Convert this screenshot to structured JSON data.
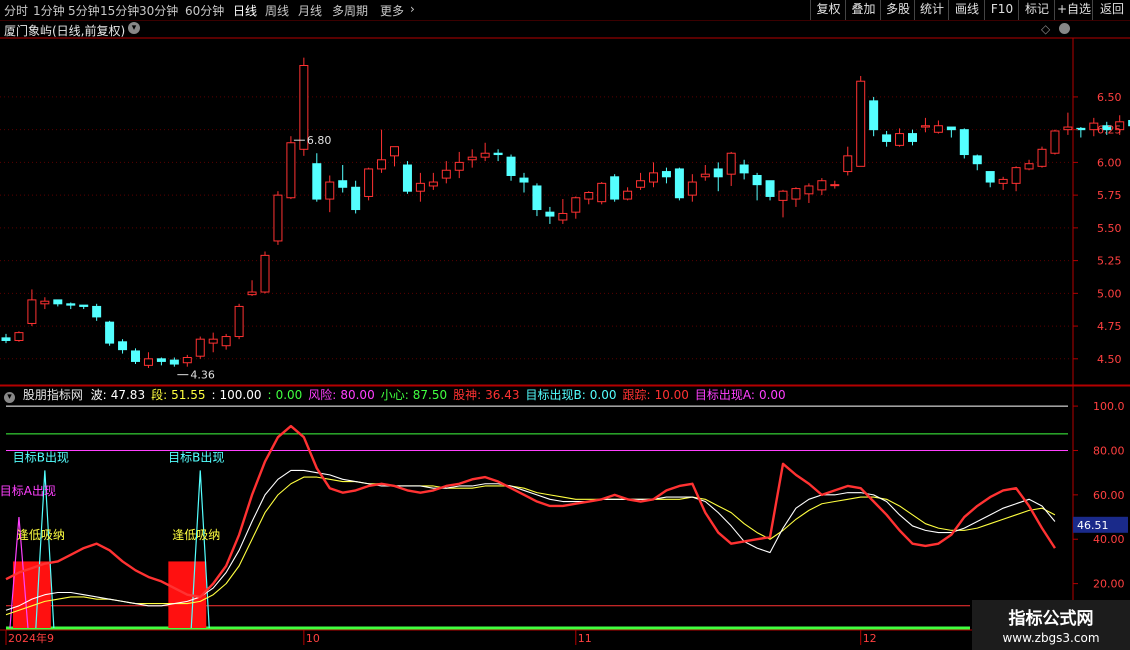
{
  "toolbar": {
    "periods": [
      "分时",
      "1分钟",
      "5分钟",
      "15分钟",
      "30分钟",
      "60分钟",
      "日线",
      "周线",
      "月线",
      "多周期",
      "更多"
    ],
    "active_period": "日线",
    "right_buttons": [
      "复权",
      "叠加",
      "多股",
      "统计",
      "画线",
      "F10",
      "标记",
      "+自选",
      "返回"
    ]
  },
  "title": {
    "stock_name": "厦门象屿(日线,前复权)"
  },
  "colors": {
    "up": "#ff3232",
    "down": "#54ffff",
    "grid": "#5a0000",
    "axis": "#b40000",
    "wave_line": "#ff2020",
    "seg_line": "#ffff40",
    "mid_line": "#ffffff",
    "target_b": "#54ffff",
    "target_a": "#ff40ff"
  },
  "chart_data": [
    {
      "type": "candlestick",
      "title": "厦门象屿(日线,前复权)",
      "ylim": [
        4.3,
        6.95
      ],
      "y_ticks": [
        "6.50",
        "6.25",
        "6.00",
        "5.75",
        "5.50",
        "5.25",
        "5.00",
        "4.75",
        "4.50"
      ],
      "annotations": [
        {
          "text": "6.80",
          "candle_index": 22
        },
        {
          "text": "4.36",
          "candle_index": 13
        }
      ],
      "candles": [
        [
          4.66,
          4.64,
          4.69,
          4.62
        ],
        [
          4.64,
          4.7,
          4.71,
          4.63
        ],
        [
          4.77,
          4.95,
          5.03,
          4.75
        ],
        [
          4.92,
          4.94,
          4.97,
          4.88
        ],
        [
          4.95,
          4.92,
          4.95,
          4.9
        ],
        [
          4.92,
          4.91,
          4.93,
          4.88
        ],
        [
          4.91,
          4.9,
          4.91,
          4.88
        ],
        [
          4.9,
          4.82,
          4.92,
          4.79
        ],
        [
          4.78,
          4.62,
          4.79,
          4.6
        ],
        [
          4.63,
          4.57,
          4.65,
          4.54
        ],
        [
          4.56,
          4.48,
          4.58,
          4.46
        ],
        [
          4.45,
          4.5,
          4.55,
          4.43
        ],
        [
          4.5,
          4.48,
          4.51,
          4.45
        ],
        [
          4.49,
          4.46,
          4.51,
          4.44
        ],
        [
          4.47,
          4.51,
          4.53,
          4.44
        ],
        [
          4.52,
          4.65,
          4.67,
          4.5
        ],
        [
          4.62,
          4.65,
          4.7,
          4.55
        ],
        [
          4.6,
          4.67,
          4.69,
          4.57
        ],
        [
          4.67,
          4.9,
          4.92,
          4.65
        ],
        [
          4.99,
          5.01,
          5.1,
          4.98
        ],
        [
          5.01,
          5.29,
          5.32,
          5.0
        ],
        [
          5.4,
          5.75,
          5.78,
          5.37
        ],
        [
          5.73,
          6.15,
          6.2,
          5.72
        ],
        [
          6.1,
          6.74,
          6.8,
          6.05
        ],
        [
          5.99,
          5.72,
          6.07,
          5.7
        ],
        [
          5.72,
          5.85,
          5.9,
          5.62
        ],
        [
          5.86,
          5.81,
          5.98,
          5.77
        ],
        [
          5.81,
          5.64,
          5.86,
          5.61
        ],
        [
          5.74,
          5.95,
          5.96,
          5.71
        ],
        [
          5.95,
          6.02,
          6.25,
          5.92
        ],
        [
          6.05,
          6.12,
          6.12,
          5.97
        ],
        [
          5.98,
          5.78,
          6.01,
          5.76
        ],
        [
          5.78,
          5.84,
          5.92,
          5.7
        ],
        [
          5.82,
          5.85,
          5.92,
          5.79
        ],
        [
          5.88,
          5.94,
          6.01,
          5.84
        ],
        [
          5.94,
          6.0,
          6.08,
          5.88
        ],
        [
          6.02,
          6.04,
          6.1,
          5.96
        ],
        [
          6.04,
          6.07,
          6.15,
          6.01
        ],
        [
          6.07,
          6.06,
          6.1,
          6.01
        ],
        [
          6.04,
          5.9,
          6.06,
          5.86
        ],
        [
          5.88,
          5.85,
          5.92,
          5.77
        ],
        [
          5.82,
          5.64,
          5.84,
          5.59
        ],
        [
          5.62,
          5.59,
          5.66,
          5.53
        ],
        [
          5.56,
          5.61,
          5.72,
          5.53
        ],
        [
          5.62,
          5.73,
          5.74,
          5.57
        ],
        [
          5.72,
          5.77,
          5.78,
          5.68
        ],
        [
          5.7,
          5.84,
          5.85,
          5.68
        ],
        [
          5.89,
          5.72,
          5.91,
          5.7
        ],
        [
          5.72,
          5.78,
          5.81,
          5.71
        ],
        [
          5.81,
          5.86,
          5.92,
          5.79
        ],
        [
          5.85,
          5.92,
          6.0,
          5.81
        ],
        [
          5.93,
          5.89,
          5.96,
          5.84
        ],
        [
          5.95,
          5.73,
          5.96,
          5.71
        ],
        [
          5.75,
          5.85,
          5.91,
          5.7
        ],
        [
          5.89,
          5.91,
          5.98,
          5.86
        ],
        [
          5.95,
          5.89,
          6.0,
          5.78
        ],
        [
          5.91,
          6.07,
          6.08,
          5.82
        ],
        [
          5.98,
          5.92,
          6.02,
          5.87
        ],
        [
          5.9,
          5.83,
          5.92,
          5.71
        ],
        [
          5.86,
          5.74,
          5.86,
          5.71
        ],
        [
          5.71,
          5.78,
          5.79,
          5.58
        ],
        [
          5.72,
          5.8,
          5.81,
          5.66
        ],
        [
          5.76,
          5.82,
          5.84,
          5.69
        ],
        [
          5.79,
          5.86,
          5.88,
          5.75
        ],
        [
          5.83,
          5.83,
          5.86,
          5.8
        ],
        [
          5.93,
          6.05,
          6.12,
          5.9
        ],
        [
          5.97,
          6.62,
          6.66,
          5.98
        ],
        [
          6.47,
          6.25,
          6.5,
          6.2
        ],
        [
          6.21,
          6.16,
          6.24,
          6.12
        ],
        [
          6.13,
          6.22,
          6.26,
          6.12
        ],
        [
          6.22,
          6.16,
          6.25,
          6.13
        ],
        [
          6.27,
          6.28,
          6.34,
          6.23
        ],
        [
          6.23,
          6.28,
          6.32,
          6.22
        ],
        [
          6.27,
          6.25,
          6.27,
          6.19
        ],
        [
          6.25,
          6.06,
          6.26,
          6.03
        ],
        [
          6.05,
          5.99,
          6.06,
          5.94
        ],
        [
          5.93,
          5.85,
          5.93,
          5.81
        ],
        [
          5.84,
          5.87,
          5.89,
          5.79
        ],
        [
          5.84,
          5.96,
          5.97,
          5.78
        ],
        [
          5.95,
          5.99,
          6.02,
          5.94
        ],
        [
          5.97,
          6.1,
          6.12,
          5.96
        ],
        [
          6.07,
          6.24,
          6.25,
          6.06
        ],
        [
          6.25,
          6.27,
          6.38,
          6.21
        ],
        [
          6.26,
          6.25,
          6.27,
          6.19
        ],
        [
          6.25,
          6.3,
          6.34,
          6.2
        ],
        [
          6.28,
          6.25,
          6.31,
          6.21
        ],
        [
          6.25,
          6.31,
          6.36,
          6.21
        ],
        [
          6.32,
          6.28,
          6.35,
          6.22
        ],
        [
          6.27,
          6.13,
          6.33,
          6.1
        ],
        [
          6.1,
          5.95,
          6.17,
          5.93
        ],
        [
          5.95,
          5.84,
          5.97,
          5.8
        ],
        [
          5.86,
          5.86,
          5.88,
          5.77
        ]
      ]
    },
    {
      "type": "line",
      "title": "股朋指标网",
      "ylim": [
        0,
        105
      ],
      "y_ticks": [
        "100.0",
        "80.00",
        "60.00",
        "40.00",
        "20.00"
      ],
      "current_value": "46.51",
      "x_ticks": [
        {
          "label": "2024年9",
          "index": 0
        },
        {
          "label": "10",
          "index": 23
        },
        {
          "label": "11",
          "index": 44
        },
        {
          "label": "12",
          "index": 66
        }
      ],
      "header": [
        {
          "label": "波:",
          "value": "47.83",
          "color": "#ffffff"
        },
        {
          "label": "段:",
          "value": "51.55",
          "color": "#ffff40"
        },
        {
          "label": ":",
          "value": "100.00",
          "color": "#ffffff"
        },
        {
          "label": ":",
          "value": "0.00",
          "color": "#40ff40"
        },
        {
          "label": "风险:",
          "value": "80.00",
          "color": "#ff40ff"
        },
        {
          "label": "小心:",
          "value": "87.50",
          "color": "#40ff40"
        },
        {
          "label": "股神:",
          "value": "36.43",
          "color": "#ff3232"
        },
        {
          "label": "目标出现B:",
          "value": "0.00",
          "color": "#54ffff"
        },
        {
          "label": "跟踪:",
          "value": "10.00",
          "color": "#ff3232"
        },
        {
          "label": "目标出现A:",
          "value": "0.00",
          "color": "#ff40ff"
        }
      ],
      "hlines": [
        {
          "value": 100,
          "color": "#ffffff"
        },
        {
          "value": 87.5,
          "color": "#40ff40"
        },
        {
          "value": 80,
          "color": "#ff40ff"
        },
        {
          "value": 10,
          "color": "#ff3232"
        },
        {
          "value": 0,
          "color": "#40ff40"
        }
      ],
      "series": [
        {
          "key": "guoshen",
          "color": "#ff3232",
          "values": [
            22,
            25,
            27,
            29,
            30,
            33,
            36,
            38,
            35,
            30,
            26,
            23,
            21,
            18,
            15,
            14,
            20,
            28,
            42,
            60,
            75,
            86,
            91,
            86,
            72,
            63,
            61,
            62,
            64,
            65,
            64,
            62,
            61,
            62,
            64,
            65,
            67,
            68,
            66,
            63,
            60,
            57,
            55,
            55,
            56,
            57,
            58,
            60,
            58,
            57,
            58,
            62,
            64,
            65,
            52,
            43,
            38,
            39,
            40,
            41,
            74,
            69,
            65,
            60,
            62,
            64,
            63,
            57,
            51,
            44,
            38,
            37,
            38,
            42,
            50,
            55,
            59,
            62,
            63,
            55,
            45,
            36
          ]
        },
        {
          "key": "wave",
          "color": "#ffffff",
          "values": [
            8,
            10,
            13,
            15,
            16,
            16,
            15,
            14,
            13,
            12,
            11,
            10,
            10,
            11,
            12,
            14,
            18,
            25,
            35,
            48,
            60,
            67,
            71,
            71,
            70,
            69,
            67,
            66,
            65,
            64,
            64,
            64,
            64,
            63,
            63,
            64,
            64,
            65,
            65,
            64,
            62,
            60,
            58,
            57,
            57,
            57,
            58,
            58,
            58,
            58,
            58,
            59,
            59,
            59,
            57,
            52,
            46,
            39,
            36,
            34,
            45,
            54,
            58,
            60,
            60,
            61,
            61,
            60,
            57,
            51,
            46,
            44,
            43,
            43,
            45,
            48,
            51,
            54,
            56,
            58,
            55,
            48
          ]
        },
        {
          "key": "segment",
          "color": "#ffff40",
          "values": [
            6,
            8,
            10,
            12,
            13,
            14,
            14,
            13,
            13,
            12,
            11,
            11,
            11,
            11,
            11,
            12,
            15,
            20,
            28,
            40,
            52,
            60,
            65,
            68,
            68,
            67,
            66,
            66,
            65,
            65,
            64,
            64,
            64,
            64,
            63,
            63,
            63,
            64,
            64,
            64,
            63,
            61,
            60,
            59,
            58,
            58,
            58,
            58,
            58,
            58,
            58,
            58,
            58,
            59,
            58,
            55,
            52,
            47,
            43,
            40,
            44,
            49,
            53,
            56,
            57,
            58,
            59,
            59,
            58,
            55,
            51,
            47,
            45,
            44,
            44,
            45,
            47,
            49,
            51,
            53,
            54,
            51
          ]
        }
      ],
      "red_boxes": [
        {
          "start": 1,
          "end": 3,
          "top": 30
        },
        {
          "start": 13,
          "end": 15,
          "top": 30
        }
      ],
      "spikes": [
        {
          "index": 1,
          "value": 50,
          "color": "#ff40ff"
        },
        {
          "index": 3,
          "value": 71,
          "color": "#54ffff"
        },
        {
          "index": 15,
          "value": 71,
          "color": "#54ffff"
        }
      ],
      "labels": [
        {
          "text": "目标B出现",
          "index": 3,
          "value": 75,
          "color": "#54ffff"
        },
        {
          "text": "目标B出现",
          "index": 15,
          "value": 75,
          "color": "#54ffff"
        },
        {
          "text": "目标A出现",
          "index": 2,
          "value": 60,
          "color": "#ff40ff"
        },
        {
          "text": "逢低吸纳",
          "index": 3,
          "value": 40,
          "color": "#ffff40"
        },
        {
          "text": "逢低吸纳",
          "index": 15,
          "value": 40,
          "color": "#ffff40"
        }
      ]
    }
  ],
  "watermark": {
    "title": "指标公式网",
    "url": "www.zbgs3.com"
  }
}
